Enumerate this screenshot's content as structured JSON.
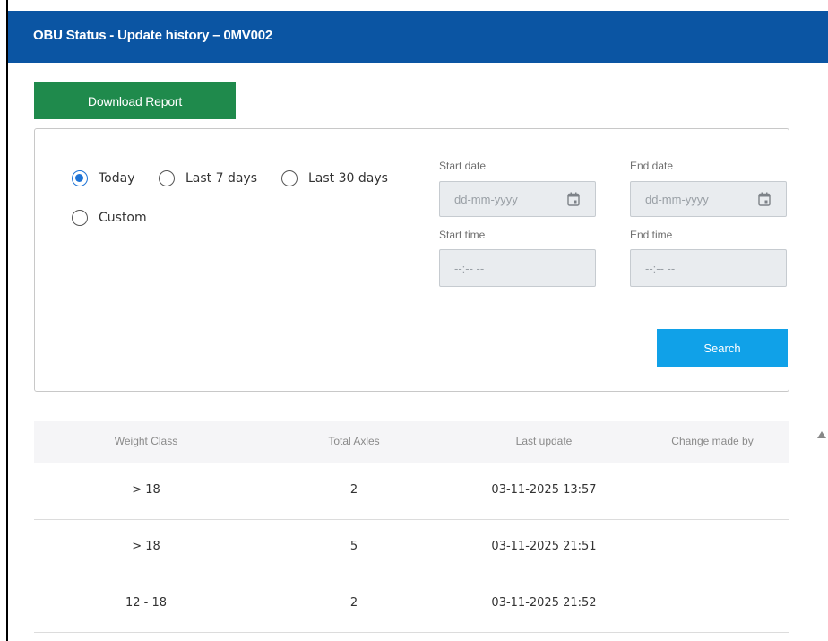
{
  "header": {
    "title": "OBU Status - Update history – 0MV002"
  },
  "actions": {
    "download_label": "Download Report",
    "search_label": "Search"
  },
  "filters": {
    "radios": [
      {
        "label": "Today",
        "checked": true
      },
      {
        "label": "Last 7 days",
        "checked": false
      },
      {
        "label": "Last 30 days",
        "checked": false
      },
      {
        "label": "Custom",
        "checked": false
      }
    ],
    "start_date": {
      "label": "Start date",
      "placeholder": "dd-mm-yyyy"
    },
    "end_date": {
      "label": "End date",
      "placeholder": "dd-mm-yyyy"
    },
    "start_time": {
      "label": "Start time",
      "placeholder": "--:-- --"
    },
    "end_time": {
      "label": "End time",
      "placeholder": "--:-- --"
    }
  },
  "table": {
    "columns": [
      "Weight Class",
      "Total Axles",
      "Last update",
      "Change made by"
    ],
    "rows": [
      {
        "weight_class": "> 18",
        "total_axles": "2",
        "last_update": "03-11-2025 13:57",
        "change_made_by": ""
      },
      {
        "weight_class": "> 18",
        "total_axles": "5",
        "last_update": "03-11-2025 21:51",
        "change_made_by": ""
      },
      {
        "weight_class": "12 - 18",
        "total_axles": "2",
        "last_update": "03-11-2025 21:52",
        "change_made_by": ""
      }
    ]
  },
  "icons": {
    "calendar": "calendar-icon",
    "scroll_up": "scroll-up-icon"
  },
  "colors": {
    "header_bg": "#0b55a3",
    "download_bg": "#1f8a4c",
    "search_bg": "#10a1e8",
    "radio_checked": "#1f74d6"
  }
}
